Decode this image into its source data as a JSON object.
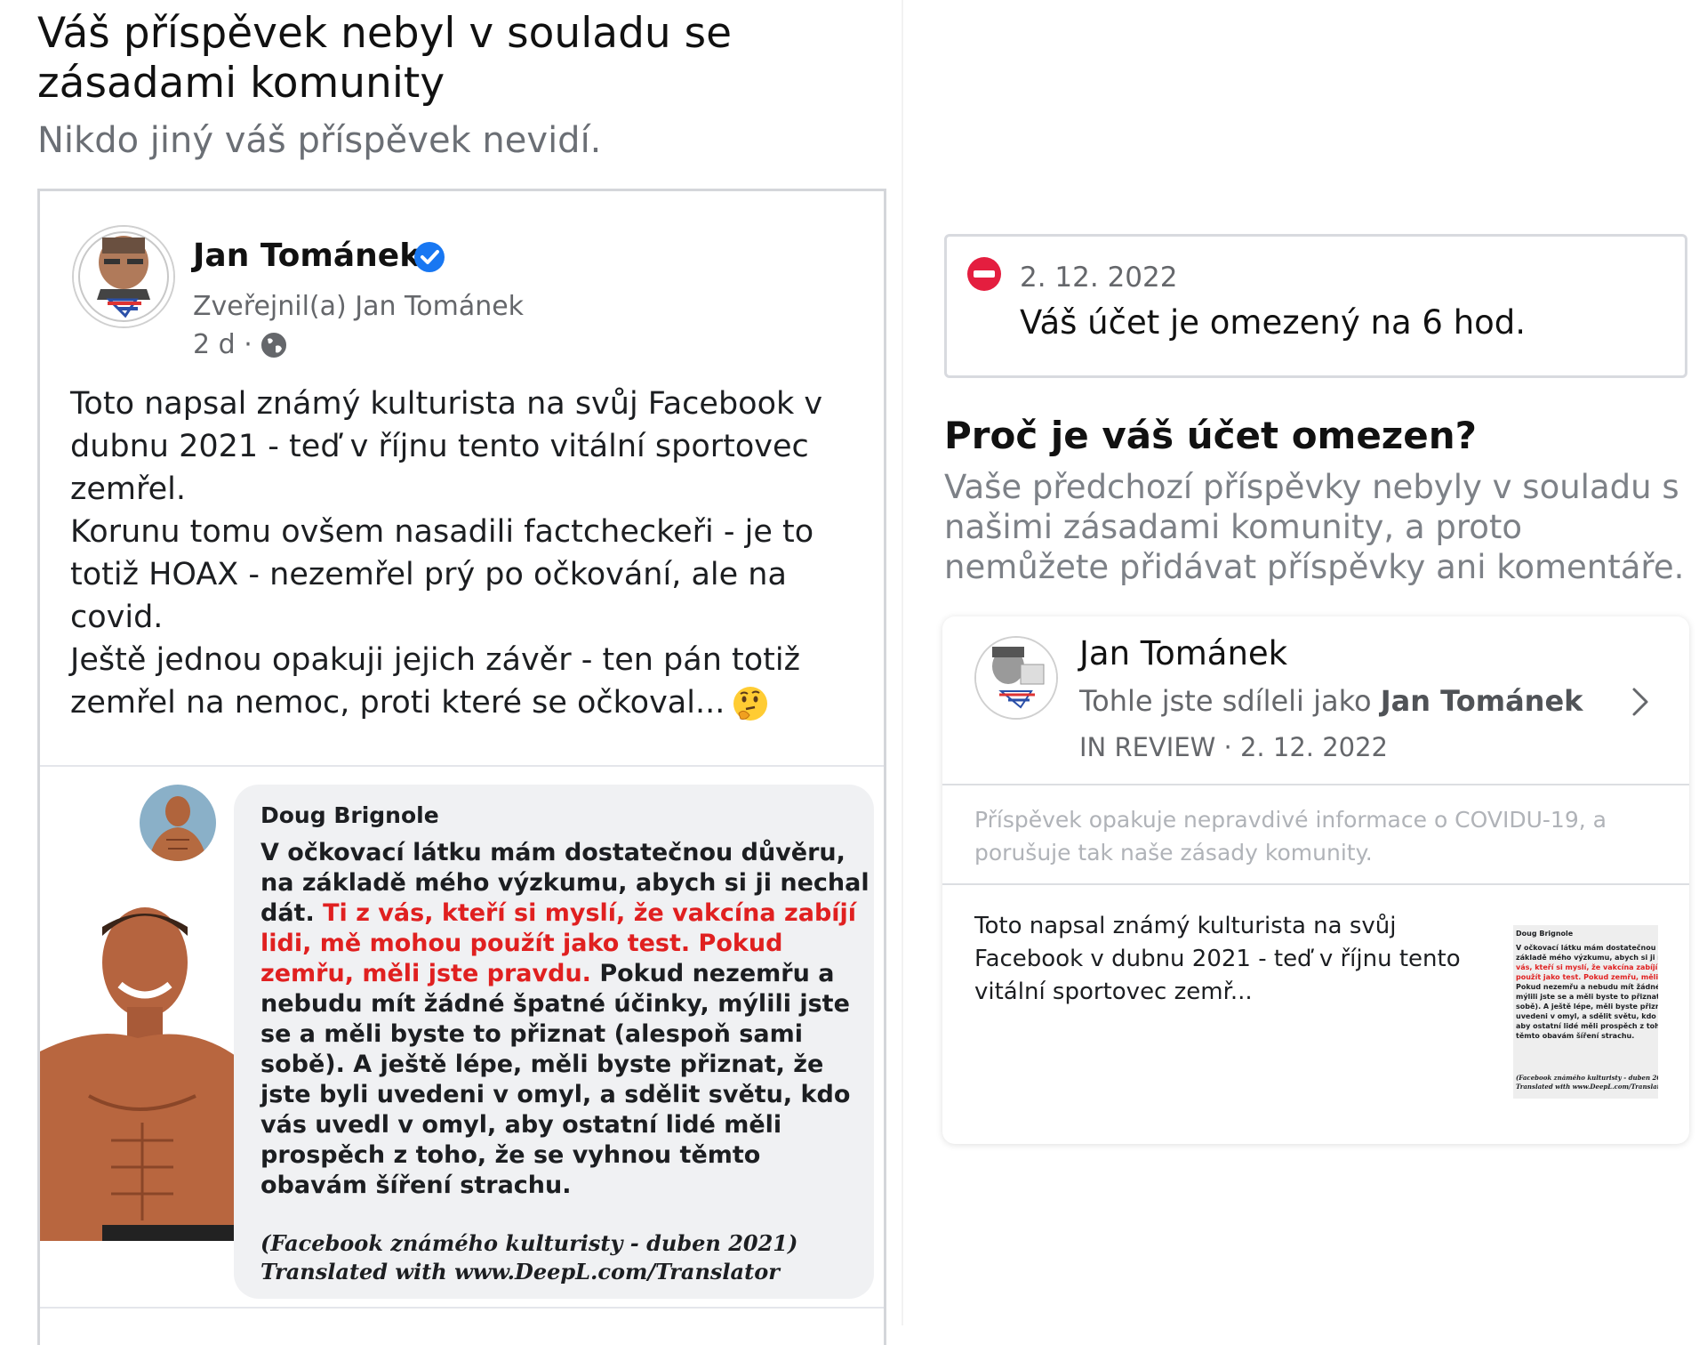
{
  "left": {
    "title": "Váš příspěvek nebyl v souladu se zásadami komunity",
    "subtitle": "Nikdo jiný váš příspěvek nevidí.",
    "post": {
      "author": "Jan Tománek",
      "shared_by": "Zveřejnil(a) Jan Tománek",
      "time": "2 d ·",
      "paragraphs": [
        "Toto napsal známý kulturista na svůj Facebook v dubnu 2021 - teď v říjnu tento vitální sportovec zemřel.",
        "Korunu tomu ovšem nasadili factcheckeři - je to totiž HOAX - nezemřel prý po očkování, ale na covid.",
        "Ještě jednou opakuji jejich závěr - ten pán totiž zemřel na nemoc, proti které se očkoval..."
      ],
      "emoji": "thinking-face",
      "image": {
        "quote_author": "Doug Brignole",
        "quote_part1": "V očkovací látku mám dostatečnou důvěru, na základě mého výzkumu, abych si ji nechal dát. ",
        "quote_red": "Ti z vás, kteří si myslí, že vakcína zabíjí lidi, mě mohou použít jako test. Pokud zemřu, měli jste pravdu.",
        "quote_part2": " Pokud nezemřu a nebudu mít žádné špatné účinky, mýlili jste se a měli byste to přiznat (alespoň sami sobě). A ještě lépe, měli byste přiznat, že jste byli uvedeni v omyl, a sdělit světu, kdo vás uvedl v omyl, aby ostatní lidé měli prospěch z toho, že se vyhnou těmto obavám šíření strachu.",
        "source_line1": "(Facebook známého kulturisty - duben 2021)",
        "source_line2": "Translated with www.DeepL.com/Translator"
      }
    }
  },
  "right": {
    "alert": {
      "date": "2. 12. 2022",
      "message": "Váš účet je omezený na 6 hod."
    },
    "why_heading": "Proč je váš účet omezen?",
    "why_body": "Vaše předchozí příspěvky nebyly v souladu s našimi zásadami komunity, a proto nemůžete přidávat příspěvky ani komentáře.",
    "review_card": {
      "name": "Jan Tománek",
      "shared_prefix": "Tohle jste sdíleli jako ",
      "shared_name": "Jan Tománek",
      "status": "IN REVIEW · 2. 12. 2022",
      "reason": "Příspěvek opakuje nepravdivé informace o COVIDU-19, a porušuje tak naše zásady komunity.",
      "preview_text": "Toto napsal známý kulturista na svůj Facebook v dubnu 2021 - teď v říjnu tento vitální sportovec zemř..."
    }
  },
  "colors": {
    "verified_blue": "#1877f2",
    "no_entry_red": "#e41e3f",
    "quote_red": "#e02020"
  }
}
